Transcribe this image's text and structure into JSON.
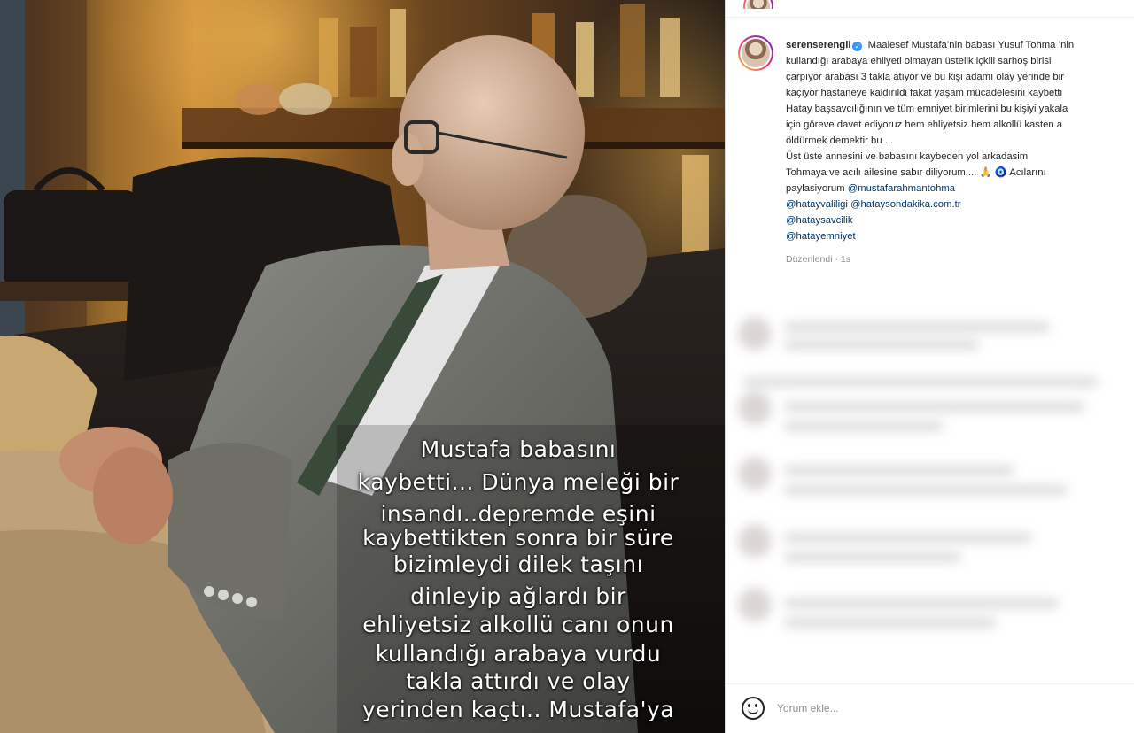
{
  "photo": {
    "caption_lines": [
      "Mustafa babasını",
      "kaybetti... Dünya meleği bir",
      "insandı..depremde eşini",
      "kaybettikten sonra bir süre",
      "bizimleydi  dilek taşını",
      "dinleyip ağlardı bir",
      "ehliyetsiz alkollü  canı onun",
      "kullandığı arabaya vurdu",
      "takla attırdı ve olay",
      "yerinden kaçtı.. Mustafa'ya"
    ]
  },
  "post": {
    "username": "serenserengil",
    "lines": [
      "Maalesef Mustafa’nin babası Yusuf Tohma ’nin",
      "kullandığı arabaya ehliyeti olmayan üstelik içkili sarhoş birisi",
      "çarpıyor arabası 3 takla atıyor ve bu kişi adamı olay yerinde bir",
      "kaçıyor hastaneye kaldırıldi fakat yaşam mücadelesini kaybetti",
      "Hatay başsavcılığının ve tüm emniyet birimlerini bu kişiyi yakala",
      "için göreve davet ediyoruz hem ehliyetsiz hem alkollü kasten a",
      "öldürmek demektir bu ...",
      "Üst üste annesini ve babasını kaybeden yol arkadasim",
      "Tohmaya ve acılı ailesine sabır diliyorum.... 🙏 🧿  Acılarını"
    ],
    "share_prefix": "paylasiyorum",
    "mentions": [
      "@mustafarahmantohma",
      "@hatayvaliligi",
      "@hataysondakika.com.tr",
      "@hataysavcilik",
      "@hatayemniyet"
    ],
    "edited_label": "Düzenlendi",
    "time": "1s"
  },
  "comment_bar": {
    "placeholder": "Yorum ekle..."
  }
}
